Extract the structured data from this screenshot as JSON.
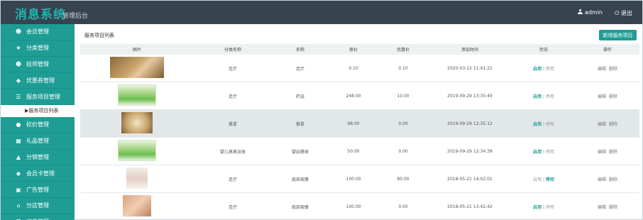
{
  "header": {
    "brand": "消息系统",
    "subtitle": "管理后台",
    "username": "admin",
    "logout": "退出"
  },
  "sidebar": {
    "items": [
      {
        "icon": "user-icon",
        "glyph": "☻",
        "label": "会员管理"
      },
      {
        "icon": "star-icon",
        "glyph": "★",
        "label": "分类管理"
      },
      {
        "icon": "user-icon",
        "glyph": "☻",
        "label": "技师管理"
      },
      {
        "icon": "tag-icon",
        "glyph": "◆",
        "label": "优惠券管理"
      },
      {
        "icon": "list-icon",
        "glyph": "☰",
        "label": "服务项目管理"
      },
      {
        "icon": "circle-icon",
        "glyph": "●",
        "label": "砍价管理"
      },
      {
        "icon": "grid-icon",
        "glyph": "▦",
        "label": "礼品管理"
      },
      {
        "icon": "bank-icon",
        "glyph": "▲",
        "label": "分销管理"
      },
      {
        "icon": "tag-icon",
        "glyph": "◆",
        "label": "会员卡管理"
      },
      {
        "icon": "film-icon",
        "glyph": "▣",
        "label": "广告管理"
      },
      {
        "icon": "home-icon",
        "glyph": "⌂",
        "label": "分店管理"
      },
      {
        "icon": "list-icon",
        "glyph": "☰",
        "label": "订单管理"
      }
    ],
    "subitem": "▶服务项目列表"
  },
  "main": {
    "title": "服务项目列表",
    "add_button": "新增服务项目"
  },
  "table": {
    "headers": [
      "图片",
      "分类名称",
      "名称",
      "原价",
      "优惠价",
      "添加时间",
      "状态",
      "操作"
    ],
    "rows": [
      {
        "thumb": "foot-spa",
        "category": "足疗",
        "name": "足疗",
        "price": "0.10",
        "discount": "0.10",
        "time": "2020-03-12 11:41:22",
        "on": "启用",
        "sep": " | ",
        "off": "停用",
        "edit": "编辑",
        "del": "删除",
        "active": "on"
      },
      {
        "thumb": "promo-green",
        "category": "足疗",
        "name": "药浴",
        "price": "248.00",
        "discount": "10.00",
        "time": "2019-09-29 13:35:49",
        "on": "启用",
        "sep": " | ",
        "off": "停用",
        "edit": "编辑",
        "del": "删除",
        "active": "on"
      },
      {
        "thumb": "massage-card",
        "category": "推拿",
        "name": "推拿",
        "price": "98.00",
        "discount": "0.00",
        "time": "2019-09-29 12:35:12",
        "on": "启用",
        "sep": " | ",
        "off": "停用",
        "edit": "编辑",
        "del": "删除",
        "active": "on"
      },
      {
        "thumb": "promo-green",
        "category": "婴儿蒸蒸浴体",
        "name": "婴幼路体",
        "price": "50.00",
        "discount": "0.00",
        "time": "2019-09-29 12:34:39",
        "on": "启用",
        "sep": " | ",
        "off": "停用",
        "edit": "编辑",
        "del": "删除",
        "active": "on"
      },
      {
        "thumb": "spa-white",
        "category": "足疗",
        "name": "肩部按摩",
        "price": "100.00",
        "discount": "80.00",
        "time": "2018-05-21 14:02:01",
        "on": "启用",
        "sep": " | ",
        "off": "停用",
        "edit": "编辑",
        "del": "删除",
        "active": "off"
      },
      {
        "thumb": "hand-spa",
        "category": "足疗",
        "name": "肩部按摩",
        "price": "100.00",
        "discount": "0.00",
        "time": "2018-05-21 13:42:42",
        "on": "启用",
        "sep": " | ",
        "off": "停用",
        "edit": "编辑",
        "del": "删除",
        "active": "on"
      }
    ]
  },
  "colors": {
    "accent": "#1e9d95",
    "topbar": "#37434f",
    "highlight_row": "#e2e8ea"
  }
}
